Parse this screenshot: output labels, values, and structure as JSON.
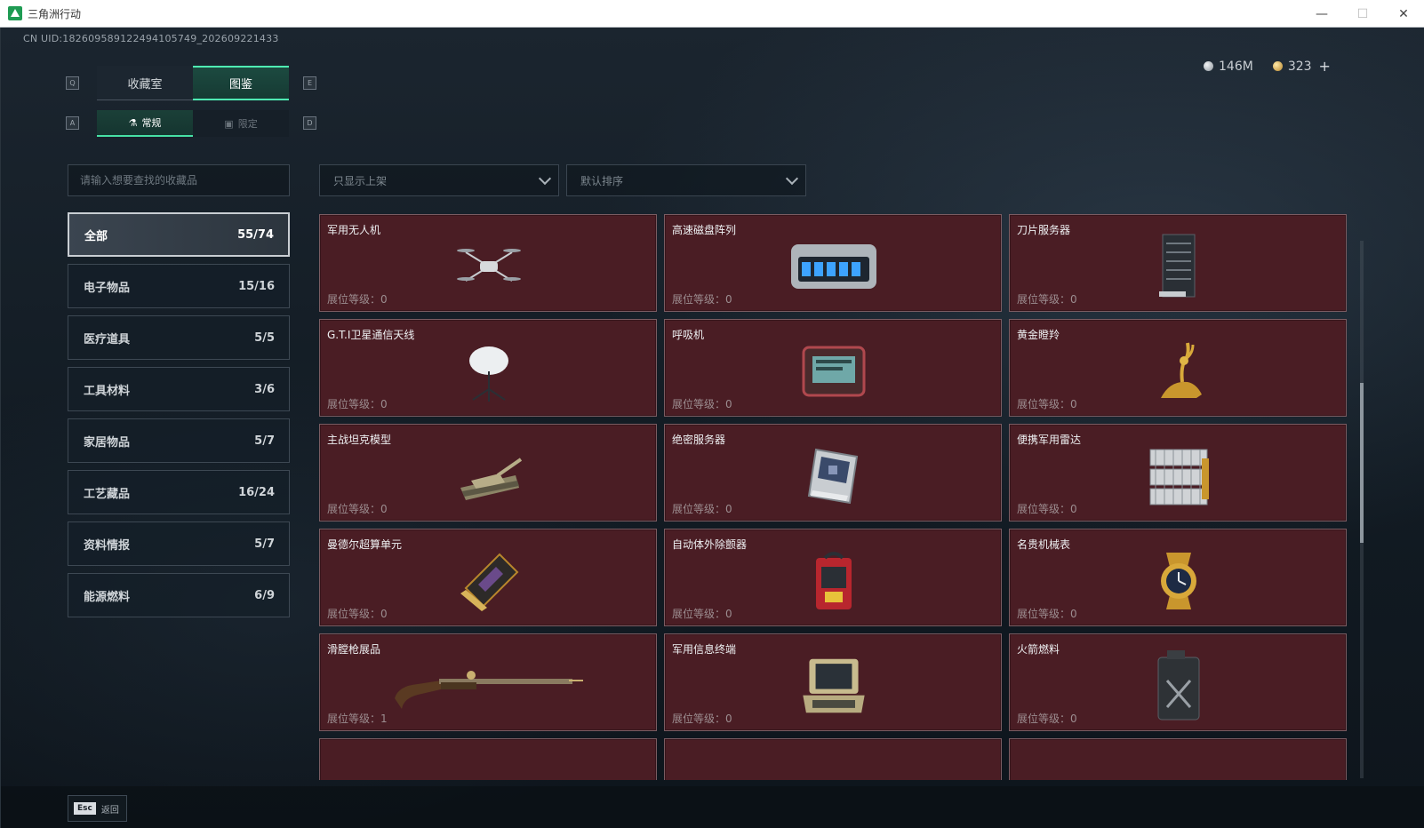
{
  "window": {
    "title": "三角洲行动",
    "minimize": "—",
    "maximize": "☐",
    "close": "✕"
  },
  "uid": "CN UID:1826095891224941057​49_202609221433",
  "currency": {
    "silver": "146M",
    "gold": "323",
    "plus": "+"
  },
  "keys": {
    "prev_tab": "Q",
    "next_tab": "E",
    "prev_sub": "A",
    "next_sub": "D"
  },
  "main_tabs": [
    {
      "label": "收藏室"
    },
    {
      "label": "图鉴"
    }
  ],
  "sub_tabs": [
    {
      "label": "常规",
      "icon": "flask-icon"
    },
    {
      "label": "限定",
      "icon": "image-icon"
    }
  ],
  "search": {
    "placeholder": "请输入想要查找的收藏品",
    "value": ""
  },
  "filter": {
    "label": "只显示上架"
  },
  "sort": {
    "label": "默认排序"
  },
  "categories": [
    {
      "label": "全部",
      "count": "55/74"
    },
    {
      "label": "电子物品",
      "count": "15/16"
    },
    {
      "label": "医疗道具",
      "count": "5/5"
    },
    {
      "label": "工具材料",
      "count": "3/6"
    },
    {
      "label": "家居物品",
      "count": "5/7"
    },
    {
      "label": "工艺藏品",
      "count": "16/24"
    },
    {
      "label": "资料情报",
      "count": "5/7"
    },
    {
      "label": "能源燃料",
      "count": "6/9"
    }
  ],
  "items": [
    {
      "name": "军用无人机",
      "level": "展位等级：0",
      "icon": "drone-icon"
    },
    {
      "name": "高速磁盘阵列",
      "level": "展位等级：0",
      "icon": "disk-array-icon"
    },
    {
      "name": "刀片服务器",
      "level": "展位等级：0",
      "icon": "blade-server-icon"
    },
    {
      "name": "G.T.I卫星通信天线",
      "level": "展位等级：0",
      "icon": "satellite-dish-icon"
    },
    {
      "name": "呼吸机",
      "level": "展位等级：0",
      "icon": "ventilator-icon"
    },
    {
      "name": "黄金瞪羚",
      "level": "展位等级：0",
      "icon": "gold-gazelle-icon"
    },
    {
      "name": "主战坦克模型",
      "level": "展位等级：0",
      "icon": "tank-model-icon"
    },
    {
      "name": "绝密服务器",
      "level": "展位等级：0",
      "icon": "secret-server-icon"
    },
    {
      "name": "便携军用雷达",
      "level": "展位等级：0",
      "icon": "radar-icon"
    },
    {
      "name": "曼德尔超算单元",
      "level": "展位等级：0",
      "icon": "compute-unit-icon"
    },
    {
      "name": "自动体外除颤器",
      "level": "展位等级：0",
      "icon": "defibrillator-icon"
    },
    {
      "name": "名贵机械表",
      "level": "展位等级：0",
      "icon": "watch-icon"
    },
    {
      "name": "滑膛枪展品",
      "level": "展位等级：1",
      "icon": "musket-icon"
    },
    {
      "name": "军用信息终端",
      "level": "展位等级：0",
      "icon": "terminal-icon"
    },
    {
      "name": "火箭燃料",
      "level": "展位等级：0",
      "icon": "fuel-can-icon"
    }
  ],
  "footer": {
    "esc_key": "Esc",
    "back_label": "返回"
  },
  "colors": {
    "accent": "#4ff3b3",
    "card_bg": "#4a1d24",
    "card_border": "#7a5c62"
  }
}
